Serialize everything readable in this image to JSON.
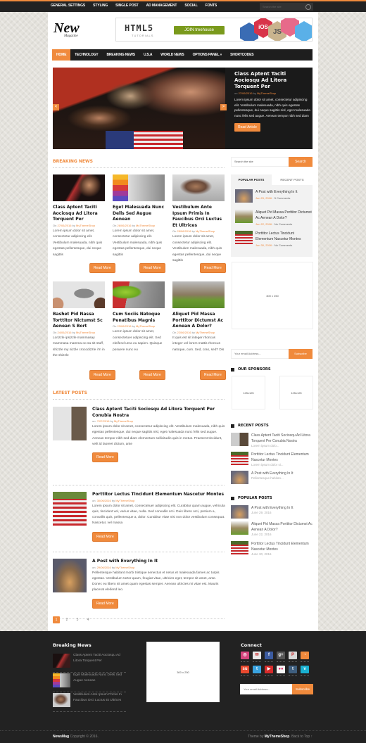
{
  "topbar": {
    "nav": [
      "GENERAL SETTINGS",
      "STYLING",
      "SINGLE POST",
      "AD MANAGEMENT",
      "SOCIAL",
      "FONTS"
    ],
    "search_placeholder": "Search the site"
  },
  "header": {
    "logo_main": "New",
    "logo_sub": "Magazine",
    "banner": {
      "title": "HTML5",
      "subtitle": "TUTORIALS",
      "cta": "JOIN treehouse",
      "tags": [
        "iOS",
        "JS"
      ]
    }
  },
  "mainnav": {
    "items": [
      "HOME",
      "TECHNOLOGY",
      "BREAKING NEWS",
      "U.S.A",
      "WORLD NEWS",
      "OPTIONS PANEL »",
      "SHORTCODES"
    ],
    "active": "HOME"
  },
  "slider": {
    "title": "Class Aptent Taciti Aociosqu Ad Litora Torquent Per",
    "meta_prefix": "on",
    "date": "27/06/2016",
    "by": "by",
    "author": "MyThemeShop",
    "excerpt": "Lorem ipsum dolor sit amet, consectetur adipiscing elit. Vestibulum malesuada, nibh quis egestas pellentesque, dui neque sagittis nisl, eget malesuada nunc felis sed augue. Aenean tempor nibh sed diam",
    "button": "Read Article",
    "prev": "<",
    "next": ">"
  },
  "breaking": {
    "heading": "BREAKING NEWS",
    "read_more": "Read More",
    "posts": [
      {
        "title": "Class Aptent Taciti Aociosqu Ad Litora Torquent Per",
        "date": "27/06/2016",
        "author": "MyThemeShop",
        "excerpt": "Lorem ipsum dolor sit amet, consectetur adipiscing elit. Vestibulum malesuada, nibh quis egestas pellentesque, dui neque sagittis"
      },
      {
        "title": "Eget Malesuada Nunc Dells Sed Augue Aenean",
        "date": "26/06/2016",
        "author": "MyThemeShop",
        "excerpt": "Lorem ipsum dolor sit amet, consectetur adipiscing elit. Vestibulum malesuada, nibh quis egestas pellentesque, dui neque sagittis"
      },
      {
        "title": "Vestibulum Ante Ipsum Primis In Faucibus Orci Luctus Et Ultrices",
        "date": "25/06/2016",
        "author": "MyThemeShop",
        "excerpt": "Lorem ipsum dolor sit amet, consectetur adipiscing elit. Vestibulum malesuada, nibh quis egestas pellentesque, dui neque sagittis"
      },
      {
        "title": "Bashet Pid Nassa Torttitor Nictumst Sc Aenean S Bort",
        "date": "24/06/2016",
        "author": "MyThemeShop",
        "excerpt": "Lorizzle ipsizzle mammasay mammasa mamma oo sa-sit stuff, shizzle my nizzle crocodizzle i'm in the shizzle"
      },
      {
        "title": "Cum Sociis Natoque Penatibus Magnis",
        "date": "23/06/2016",
        "author": "MyThemeShop",
        "excerpt": "Lorem ipsum dolor sit amet, consectetuer adipiscing elit. Sed eleifend urna eu sapien. Quisque posuere nunc eu"
      },
      {
        "title": "Aliquet Pid Massa Porttitor Dictumst Ac Aenean A Dolor?",
        "date": "22/06/2016",
        "author": "MyThemeShop",
        "excerpt": "It quis est sit integer rhoncus integer vel lorem mattis rhoncus natoque, cum. Sed, cras, sed? Dis"
      }
    ],
    "on": "On",
    "by": "by"
  },
  "latest": {
    "heading": "LATEST POSTS",
    "read_more": "Read More",
    "on": "on:",
    "by": "by",
    "posts": [
      {
        "title": "Class Aptent Taciti Sociosqu Ad Litora Torquent Per Conubia Nostra",
        "date": "7/07/2016",
        "author": "MyThemeShop",
        "excerpt": "Lorem ipsum dolor sit amet, consectetur adipiscing elit. Vestibulum malesuada, nibh quis egestas pellentesque, dui neque sagittis nisl, eget malesuada nunc felis sed augue. Aenean tempor nibh sed diam elementum sollicitudin quis in metus. Praesent tincidunt, velit id laoreet dictum, ante"
      },
      {
        "title": "Porttitor Lectus Tincidunt Elementum Nascetur Montes",
        "date": "30/06/2016",
        "author": "MyThemeShop",
        "excerpt": "Lorem ipsum dolor sit amet, consectetuer adipiscing elit. Curabitur quam augue, vehicula quis, tincidunt vel, varius vitae, nulla. Sed convallis orci. Duis libero orci, pretium a, convallis quis, pellentesque a, dolor. Curabitur vitae nisi non dolor vestibulum consequat. Nascetur, vel massa"
      },
      {
        "title": "A Post with Everything In It",
        "date": "29/06/2016",
        "author": "MyThemeShop",
        "excerpt": "Pellentesque habitant morbi tristique senectus et netus et malesuada fames ac turpis egestas. Vestibulum tortor quam, feugiat vitae, ultricies eget, tempor sit amet, ante. Donec eu libero sit amet quam egestas semper. Aenean ultricies mi vitae est. Mauris placerat eleifend leo."
      }
    ]
  },
  "pagination": {
    "pages": [
      "1",
      "2",
      "3",
      "4"
    ],
    "current": "1"
  },
  "sidebar": {
    "search": {
      "placeholder": "Search the site",
      "button": "Search"
    },
    "tabs": {
      "labels": [
        "POPULAR POSTS",
        "RECENT POSTS"
      ],
      "active": "POPULAR POSTS",
      "items": [
        {
          "title": "A Post with Everything In It",
          "date": "Jun 29, 2016",
          "comments": "5 Comments"
        },
        {
          "title": "Aliquet Pid Massa Porttitor Dictumst Ac Aenean A Dolor?",
          "date": "Jun 22, 2016",
          "comments": "No Comments"
        },
        {
          "title": "Porttitor Lectus Tincidunt Elementum Nascetur Montes",
          "date": "Jun 30, 2016",
          "comments": "No Comments"
        }
      ],
      "sep": "·"
    },
    "ad_300": "300 x 250",
    "subscribe": {
      "placeholder": "Your email Address...",
      "button": "Subscribe"
    },
    "sponsors": {
      "heading": "OUR SPONSORS",
      "ads": [
        "125x125",
        "125x125"
      ]
    },
    "recent": {
      "heading": "RECENT POSTS",
      "items": [
        {
          "title": "Class Aptent Taciti Sociosqu Ad Litora Torquent Per Conubia Nostra",
          "excerpt": "Lorem ipsum dolo..."
        },
        {
          "title": "Porttitor Lectus Tincidunt Elementum Nascetur Montes",
          "excerpt": "Lorem ipsum dolor si..."
        },
        {
          "title": "A Post with Everything In It",
          "excerpt": "Pellentesque habitan..."
        }
      ]
    },
    "popular": {
      "heading": "POPULAR POSTS",
      "items": [
        {
          "title": "A Post with Everything In It",
          "date": "June 29, 2016"
        },
        {
          "title": "Aliquet Pid Massa Porttitor Dictumst Ac Aenean A Dolor?",
          "date": "June 22, 2016"
        },
        {
          "title": "Porttitor Lectus Tincidunt Elementum Nascetur Montes",
          "date": "June 30, 2016"
        }
      ]
    }
  },
  "footer": {
    "breaking": {
      "heading": "Breaking News",
      "items": [
        "Class Aptent Taciti Aociosqu Ad Litora Torquent Per",
        "Eget Malesuada Nunc Dells Sed Augue Aenean",
        "Vestibulum Ante Ipsum Primis In Faucibus Orci Luctus Et Ultrices"
      ]
    },
    "ad": "300 x 250",
    "connect": {
      "heading": "Connect",
      "icons": [
        {
          "name": "dribbble",
          "glyph": "◎",
          "color": "#d6457e"
        },
        {
          "name": "email",
          "glyph": "✉",
          "color": "#e8e8e8"
        },
        {
          "name": "facebook",
          "glyph": "f",
          "color": "#3b5ba0"
        },
        {
          "name": "google-plus",
          "glyph": "g+",
          "color": "#555"
        },
        {
          "name": "pinterest",
          "glyph": "P",
          "color": "#d8d8d8"
        },
        {
          "name": "rss",
          "glyph": "◔",
          "color": "#f08a3c"
        },
        {
          "name": "stumbleupon",
          "glyph": "su",
          "color": "#e8492f"
        },
        {
          "name": "twitter",
          "glyph": "t",
          "color": "#3aa3e0"
        },
        {
          "name": "youtube",
          "glyph": "▶",
          "color": "#d62b2b"
        },
        {
          "name": "flickr",
          "glyph": "●●",
          "color": "#f4f4f4"
        },
        {
          "name": "tumblr",
          "glyph": "t",
          "color": "#3f5f7f"
        },
        {
          "name": "vimeo",
          "glyph": "v",
          "color": "#1ab0d0"
        }
      ],
      "subscribe_placeholder": "Your email Address...",
      "subscribe_button": "Subscribe"
    },
    "copyright_brand": "NewsMag",
    "copyright_text": "Copyright © 2016.",
    "theme_prefix": "Theme by",
    "theme_brand": "MyThemeShop",
    "back_to_top": ". Back to Top ↑"
  },
  "colors": {
    "accent": "#f08a3c",
    "dark": "#222222"
  }
}
